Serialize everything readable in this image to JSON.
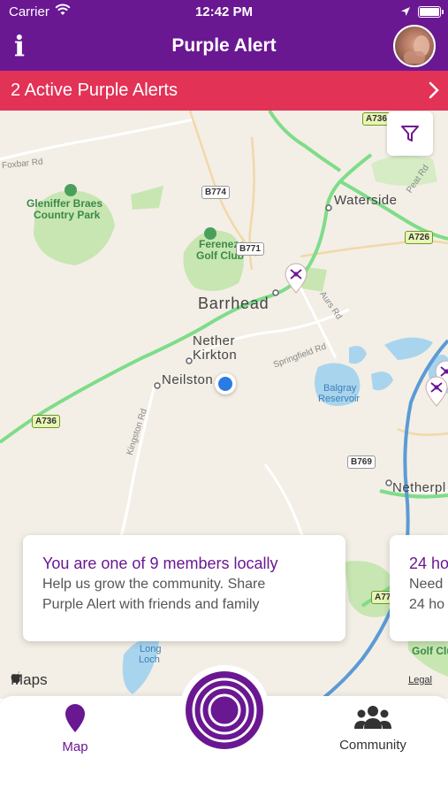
{
  "status_bar": {
    "carrier": "Carrier",
    "time": "12:42 PM"
  },
  "nav": {
    "title": "Purple Alert",
    "info_label": "i"
  },
  "alert_banner": {
    "text": "2 Active Purple Alerts"
  },
  "map": {
    "labels": {
      "foxbar_rd": "Foxbar Rd",
      "gleniffer_1": "Gleniffer Braes",
      "gleniffer_2": "Country Park",
      "fereneze_1": "Fereneze",
      "fereneze_2": "Golf Club",
      "barrhead": "Barrhead",
      "nether_1": "Nether",
      "nether_2": "Kirkton",
      "neilston": "Neilston",
      "waterside": "Waterside",
      "peat_rd": "Peat Rd",
      "aurs_rd": "Aurs Rd",
      "springfield_rd": "Springfield Rd",
      "balgray_1": "Balgray",
      "balgray_2": "Reservoir",
      "kingston_rd": "Kingston Rd",
      "netherplace": "Netherpl",
      "long_loch_1": "Long",
      "long_loch_2": "Loch",
      "golf_clu": "Golf Clu"
    },
    "shields": {
      "a736_top": "A736",
      "b774": "B774",
      "b771": "B771",
      "a726": "A726",
      "a736_left": "A736",
      "b769": "B769",
      "a77": "A77"
    },
    "attribution": {
      "logo": "Maps",
      "legal": "Legal"
    }
  },
  "cards": [
    {
      "title": "You are one of 9 members locally",
      "body_line1": "Help us grow the community. Share",
      "body_line2": "Purple Alert with friends and family"
    },
    {
      "title": "24 ho",
      "body_line1": "Need",
      "body_line2": "24 ho"
    }
  ],
  "tabbar": {
    "tabs": [
      {
        "label": "Map",
        "icon": "map-pin-icon",
        "active": true
      },
      {
        "label": "Community",
        "icon": "people-icon",
        "active": false
      }
    ],
    "center_icon": "purple-alert-target-icon"
  },
  "colors": {
    "brand_purple": "#6a1792",
    "alert_red": "#e23256",
    "map_bg": "#f3efe6",
    "road_green": "#7fdc8a",
    "water_blue": "#a8d4ee",
    "park_green": "#c7e6b2",
    "user_dot": "#2b7be4"
  }
}
